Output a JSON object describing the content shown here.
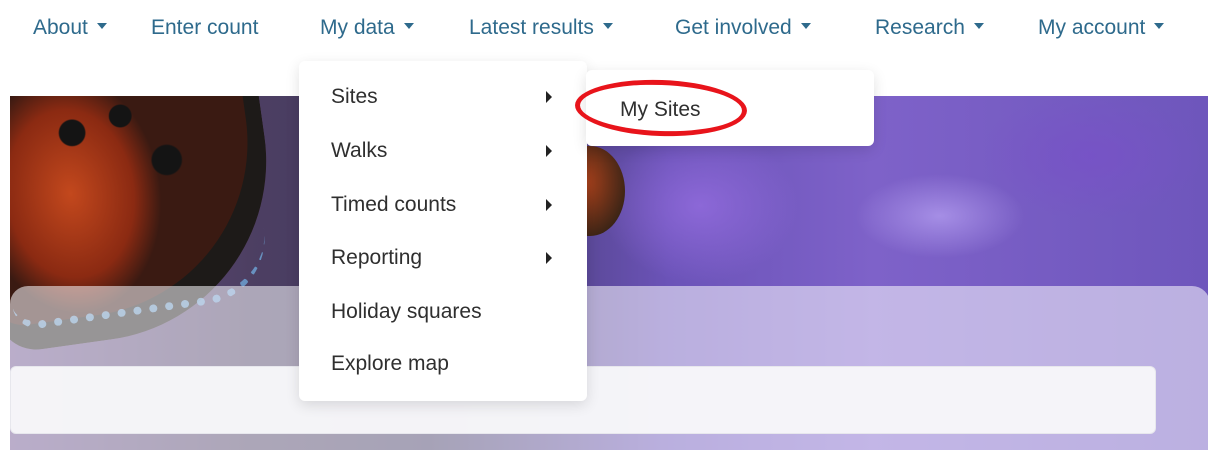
{
  "nav": {
    "items": [
      {
        "label": "About",
        "has_caret": true
      },
      {
        "label": "Enter count",
        "has_caret": false
      },
      {
        "label": "My data",
        "has_caret": true
      },
      {
        "label": "Latest results",
        "has_caret": true
      },
      {
        "label": "Get involved",
        "has_caret": true
      },
      {
        "label": "Research",
        "has_caret": true
      },
      {
        "label": "My account",
        "has_caret": true
      }
    ],
    "link_color": "#2e6a8c"
  },
  "my_data_menu": {
    "items": [
      {
        "label": "Sites",
        "has_submenu": true
      },
      {
        "label": "Walks",
        "has_submenu": true
      },
      {
        "label": "Timed counts",
        "has_submenu": true
      },
      {
        "label": "Reporting",
        "has_submenu": true
      },
      {
        "label": "Holiday squares",
        "has_submenu": false
      },
      {
        "label": "Explore map",
        "has_submenu": false
      }
    ]
  },
  "sites_submenu": {
    "items": [
      {
        "label": "My Sites",
        "highlighted": true
      }
    ],
    "highlight_color": "#e8141b"
  },
  "hero": {
    "image": "butterfly-on-purple-flower"
  }
}
